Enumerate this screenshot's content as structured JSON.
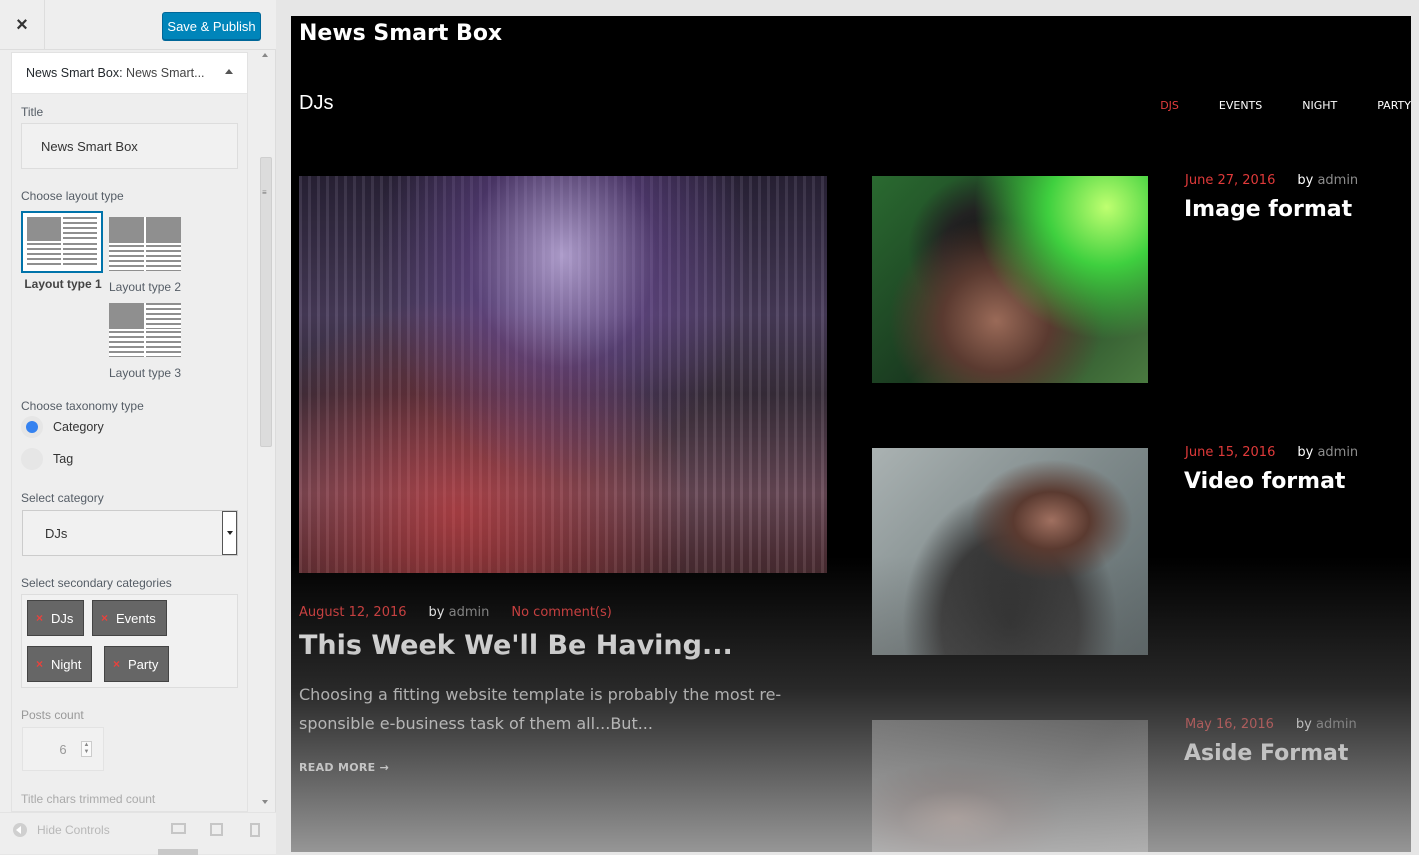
{
  "customizer": {
    "close_icon": "×",
    "publish_label": "Save & Publish",
    "section_title": "News Smart Box:",
    "section_title_muted": "News Smart...",
    "title_label": "Title",
    "title_value": "News Smart Box",
    "layout_label": "Choose layout type",
    "layouts": [
      {
        "label": "Layout type 1",
        "selected": true
      },
      {
        "label": "Layout type 2",
        "selected": false
      },
      {
        "label": "Layout type 3",
        "selected": false
      }
    ],
    "taxonomy_label": "Choose taxonomy type",
    "taxonomy_options": [
      {
        "label": "Category",
        "selected": true
      },
      {
        "label": "Tag",
        "selected": false
      }
    ],
    "category_label": "Select category",
    "category_value": "DJs",
    "secondary_label": "Select secondary categories",
    "secondary_chips": [
      "DJs",
      "Events",
      "Night",
      "Party"
    ],
    "chip_remove": "×",
    "posts_count_label": "Posts count",
    "posts_count_value": "6",
    "title_chars_label": "Title chars trimmed count",
    "hide_controls_label": "Hide Controls"
  },
  "preview": {
    "site_title": "News Smart Box",
    "category_title": "DJs",
    "nav": [
      "DJS",
      "EVENTS",
      "NIGHT",
      "PARTY"
    ],
    "nav_active": "DJS",
    "main_post": {
      "date": "August 12, 2016",
      "by": "by",
      "author": "admin",
      "comments": "No comment(s)",
      "title": "This Week We'll Be Having...",
      "excerpt_line1": "Choosing a fitting website template is probably the most re-",
      "excerpt_line2": "sponsible e-business task of them all...But...",
      "read_more": "READ MORE →"
    },
    "side_posts": [
      {
        "date": "June 27, 2016",
        "by": "by",
        "author": "admin",
        "title": "Image format"
      },
      {
        "date": "June 15, 2016",
        "by": "by",
        "author": "admin",
        "title": "Video format"
      },
      {
        "date": "May 16, 2016",
        "by": "by",
        "author": "admin",
        "title": "Aside Format"
      }
    ]
  },
  "colors": {
    "accent": "#e03a3a",
    "publish_button": "#0085ba",
    "radio_selected": "#3582f0"
  }
}
